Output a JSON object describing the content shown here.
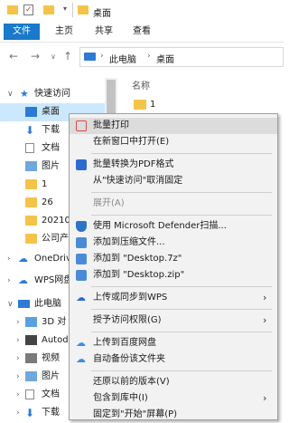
{
  "window": {
    "title": "桌面"
  },
  "ribbon": {
    "tabs": [
      "文件",
      "主页",
      "共享",
      "查看"
    ]
  },
  "address": {
    "path": [
      "此电脑",
      "桌面"
    ]
  },
  "content": {
    "column_header": "名称",
    "items": [
      "1"
    ]
  },
  "sidebar": {
    "items": [
      {
        "label": "快速访问",
        "icon": "star-icon"
      },
      {
        "label": "桌面",
        "icon": "desktop-icon"
      },
      {
        "label": "下载",
        "icon": "download-icon"
      },
      {
        "label": "文档",
        "icon": "document-icon"
      },
      {
        "label": "图片",
        "icon": "picture-icon"
      },
      {
        "label": "1",
        "icon": "folder-icon"
      },
      {
        "label": "26",
        "icon": "folder-icon"
      },
      {
        "label": "20210",
        "icon": "folder-icon"
      },
      {
        "label": "公司产",
        "icon": "folder-icon"
      },
      {
        "label": "OneDriv",
        "icon": "cloud-icon"
      },
      {
        "label": "WPS网盘",
        "icon": "cloud-icon"
      },
      {
        "label": "此电脑",
        "icon": "computer-icon"
      },
      {
        "label": "3D 对",
        "icon": "cube-icon"
      },
      {
        "label": "Autod",
        "icon": "app-icon"
      },
      {
        "label": "视频",
        "icon": "video-icon"
      },
      {
        "label": "图片",
        "icon": "picture-icon"
      },
      {
        "label": "文档",
        "icon": "document-icon"
      },
      {
        "label": "下载",
        "icon": "download-icon"
      }
    ]
  },
  "context_menu": {
    "items": [
      {
        "label": "批量打印",
        "icon": "printer-icon",
        "color": "#e04a4a"
      },
      {
        "label": "在新窗口中打开(E)"
      },
      {
        "label": "批量转换为PDF格式",
        "icon": "pdf-icon",
        "color": "#2e6bd1"
      },
      {
        "label": "从\"快速访问\"取消固定"
      },
      {
        "label": "展开(A)",
        "disabled": true
      },
      {
        "label": "使用 Microsoft Defender扫描...",
        "icon": "shield-icon",
        "color": "#2b74c9"
      },
      {
        "label": "添加到压缩文件...",
        "icon": "archive-icon",
        "color": "#4a8bd8"
      },
      {
        "label": "添加到 \"Desktop.7z\"",
        "icon": "archive-icon",
        "color": "#4a8bd8"
      },
      {
        "label": "添加到 \"Desktop.zip\"",
        "icon": "archive-icon",
        "color": "#4a8bd8"
      },
      {
        "label": "上传或同步到WPS",
        "icon": "cloud-icon",
        "color": "#2e6bd1"
      },
      {
        "label": "授予访问权限(G)"
      },
      {
        "label": "上传到百度网盘",
        "icon": "baidu-icon",
        "color": "#3a8ee6"
      },
      {
        "label": "自动备份该文件夹",
        "icon": "baidu-icon",
        "color": "#3a8ee6"
      },
      {
        "label": "还原以前的版本(V)"
      },
      {
        "label": "包含到库中(I)"
      },
      {
        "label": "固定到\"开始\"屏幕(P)"
      }
    ]
  }
}
